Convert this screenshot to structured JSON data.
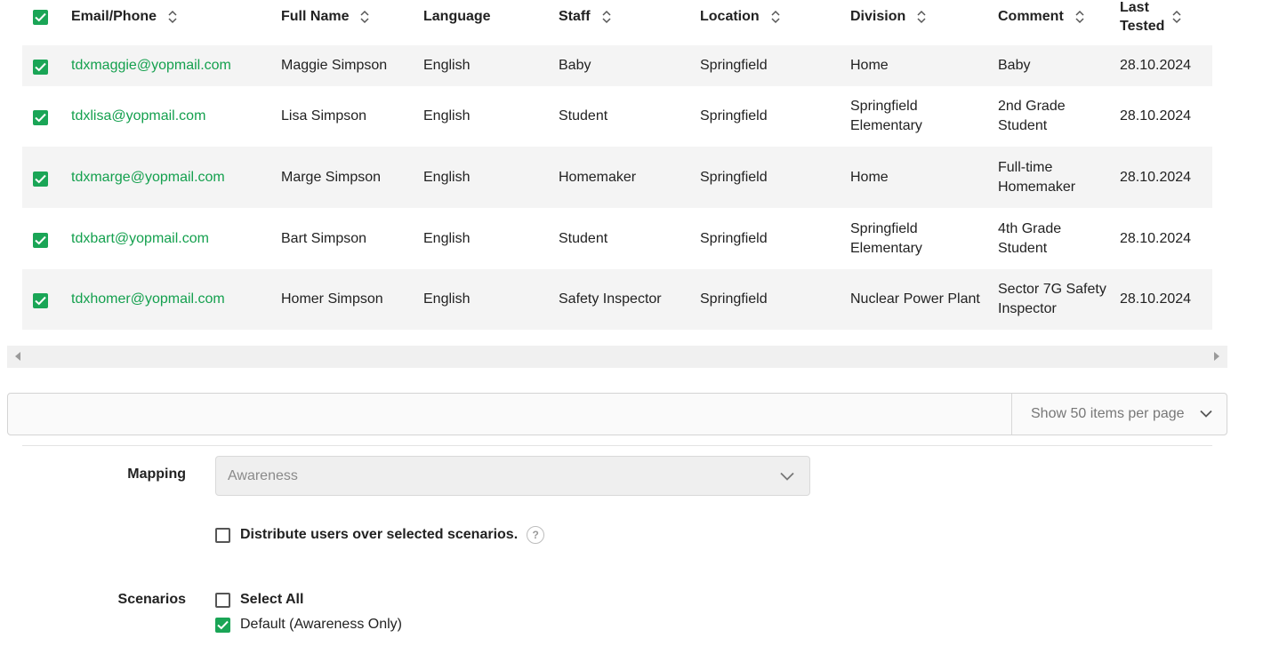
{
  "table": {
    "columns": [
      "Email/Phone",
      "Full Name",
      "Language",
      "Staff",
      "Location",
      "Division",
      "Comment",
      "Last Tested"
    ],
    "rows": [
      {
        "email": "tdxmaggie@yopmail.com",
        "name": "Maggie Simpson",
        "language": "English",
        "staff": "Baby",
        "location": "Springfield",
        "division": "Home",
        "comment": "Baby",
        "tested": "28.10.2024",
        "checked": true
      },
      {
        "email": "tdxlisa@yopmail.com",
        "name": "Lisa Simpson",
        "language": "English",
        "staff": "Student",
        "location": "Springfield",
        "division": "Springfield Elementary",
        "comment": "2nd Grade Student",
        "tested": "28.10.2024",
        "checked": true
      },
      {
        "email": "tdxmarge@yopmail.com",
        "name": "Marge Simpson",
        "language": "English",
        "staff": "Homemaker",
        "location": "Springfield",
        "division": "Home",
        "comment": "Full-time Homemaker",
        "tested": "28.10.2024",
        "checked": true
      },
      {
        "email": "tdxbart@yopmail.com",
        "name": "Bart Simpson",
        "language": "English",
        "staff": "Student",
        "location": "Springfield",
        "division": "Springfield Elementary",
        "comment": "4th Grade Student",
        "tested": "28.10.2024",
        "checked": true
      },
      {
        "email": "tdxhomer@yopmail.com",
        "name": "Homer Simpson",
        "language": "English",
        "staff": "Safety Inspector",
        "location": "Springfield",
        "division": "Nuclear Power Plant",
        "comment": "Sector 7G Safety Inspector",
        "tested": "28.10.2024",
        "checked": true
      }
    ]
  },
  "pager": {
    "per_page_label": "Show 50 items per page"
  },
  "form": {
    "mapping_label": "Mapping",
    "mapping_value": "Awareness",
    "distribute_label": "Distribute users over selected scenarios.",
    "help_glyph": "?",
    "scenarios_label": "Scenarios",
    "select_all_label": "Select All",
    "scenario_options": [
      {
        "label": "Default (Awareness Only)",
        "checked": true
      }
    ]
  },
  "colors": {
    "accent": "#1aa556",
    "email_link": "#14a04e",
    "row_shade": "#f4f4f4"
  }
}
